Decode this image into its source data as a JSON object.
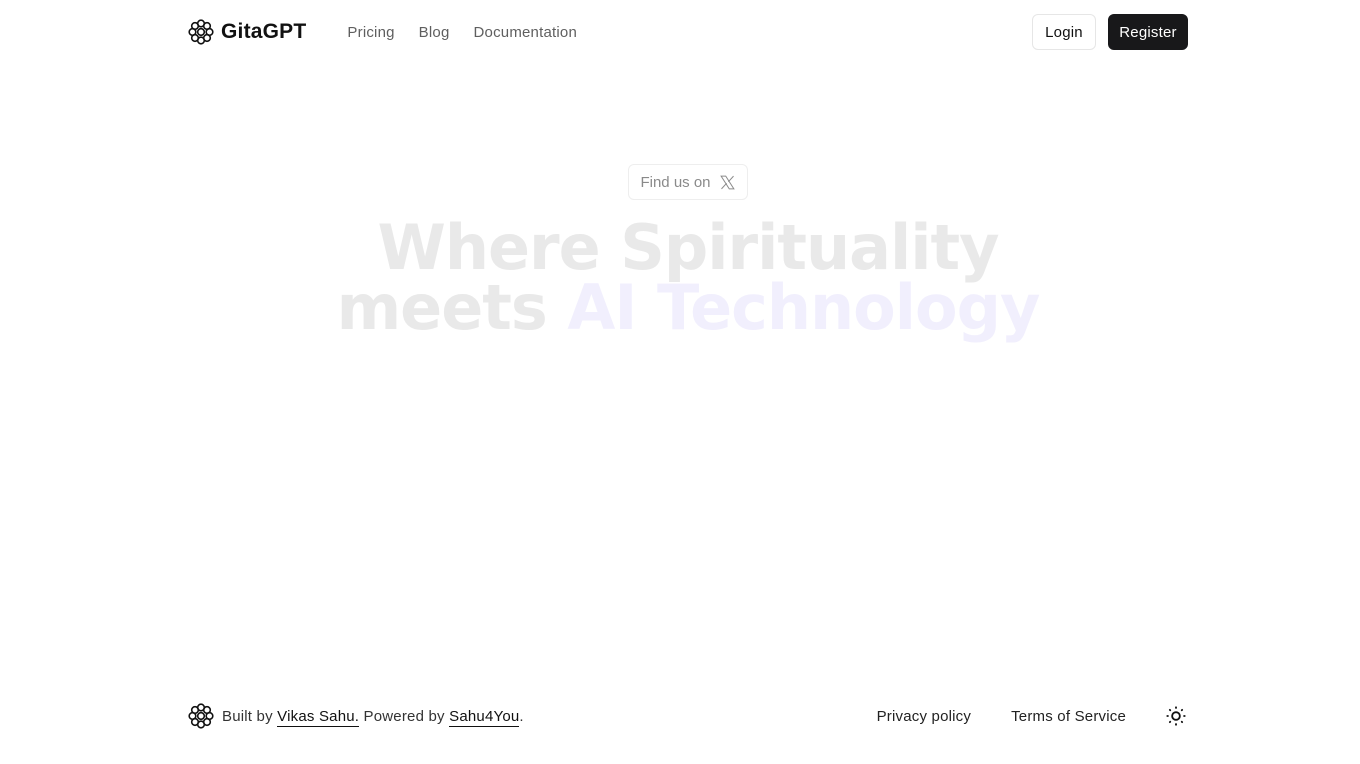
{
  "header": {
    "brand_name": "GitaGPT",
    "logo_icon": "flower-circles-icon",
    "nav": [
      {
        "label": "Pricing"
      },
      {
        "label": "Blog"
      },
      {
        "label": "Documentation"
      }
    ],
    "login_label": "Login",
    "register_label": "Register"
  },
  "hero": {
    "pill_label": "Find us on",
    "pill_icon": "x-logo-icon",
    "title_line1": "Where Spirituality",
    "title_line2_prefix": "meets",
    "title_line2_accent": "AI Technology",
    "colors": {
      "title": "#e9e9e9",
      "accent": "#f1effd"
    }
  },
  "footer": {
    "built_by_prefix": "Built by",
    "author": "Vikas Sahu",
    "powered_by_prefix": "Powered by",
    "powered_by": "Sahu4You",
    "period": ".",
    "links": [
      {
        "label": "Privacy policy"
      },
      {
        "label": "Terms of Service"
      }
    ],
    "theme_toggle_icon": "sun-icon"
  },
  "colors": {
    "primary_button_bg": "#18181a",
    "primary_button_text": "#ffffff",
    "nav_text": "#5f5f5f",
    "background": "#ffffff"
  }
}
